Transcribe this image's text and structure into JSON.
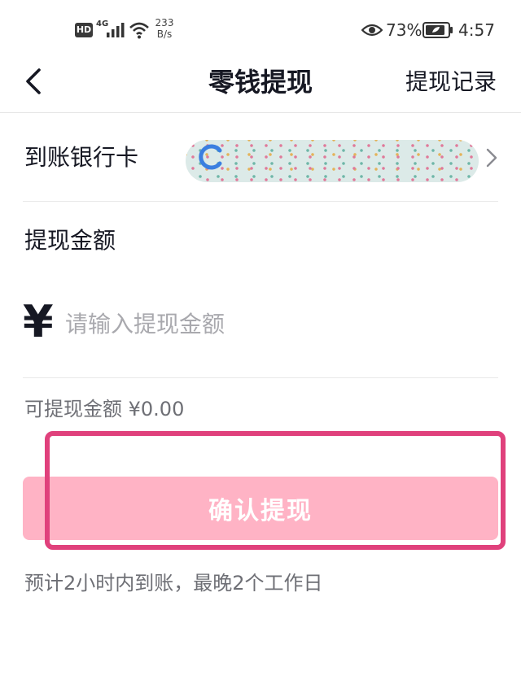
{
  "status_bar": {
    "hd": "HD",
    "network": "4G",
    "speed_value": "233",
    "speed_unit": "B/s",
    "battery_percent": "73%",
    "time": "4:57"
  },
  "nav": {
    "title": "零钱提现",
    "history_link": "提现记录"
  },
  "bank": {
    "label": "到账银行卡"
  },
  "amount": {
    "label": "提现金额",
    "currency_symbol": "¥",
    "placeholder": "请输入提现金额"
  },
  "available_text": "可提现金额 ¥0.00",
  "confirm_button": "确认提现",
  "eta_note": "预计2小时内到账，最晚2个工作日",
  "colors": {
    "accent_pink": "#ffb3c5",
    "highlight_border": "#e0417c",
    "text_primary": "#161823",
    "text_secondary": "#6e6f75"
  }
}
